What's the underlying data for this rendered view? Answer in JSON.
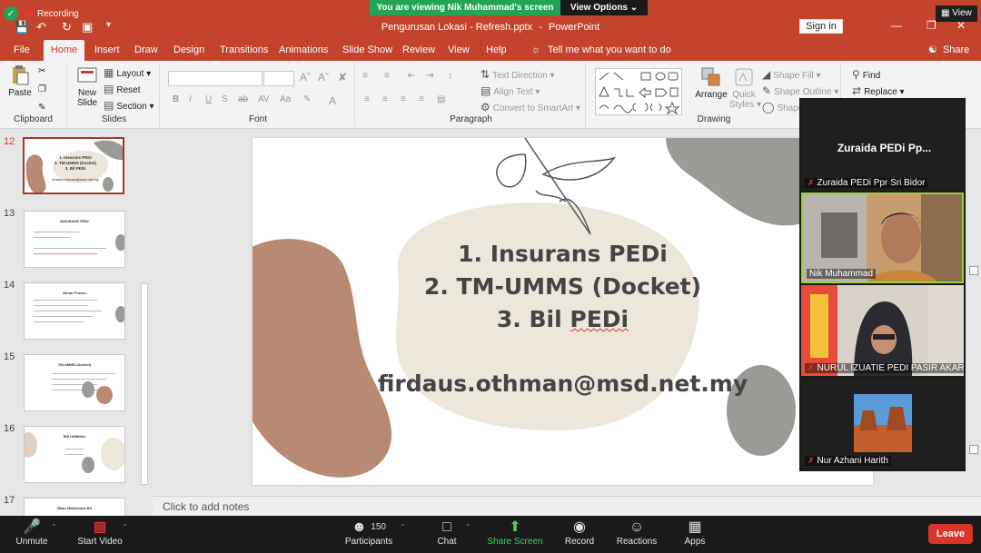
{
  "zoom_top": {
    "recording": "Recording",
    "viewing_banner": "You are viewing Nik Muhammad's screen",
    "view_options": "View Options",
    "view": "View"
  },
  "titlebar": {
    "doc_title": "Pengurusan Lokasi - Refresh.pptx",
    "separator": "-",
    "app_name": "PowerPoint",
    "sign_in": "Sign in"
  },
  "tabs": [
    "File",
    "Home",
    "Insert",
    "Draw",
    "Design",
    "Transitions",
    "Animations",
    "Slide Show",
    "Review",
    "View",
    "Help"
  ],
  "tell_me": "Tell me what you want to do",
  "share": "Share",
  "ribbon": {
    "clipboard": {
      "label": "Clipboard",
      "paste": "Paste"
    },
    "slides": {
      "label": "Slides",
      "new_slide": "New",
      "new_slide2": "Slide",
      "layout": "Layout",
      "reset": "Reset",
      "section": "Section"
    },
    "font": {
      "label": "Font"
    },
    "paragraph": {
      "label": "Paragraph",
      "text_direction": "Text Direction",
      "align_text": "Align Text",
      "smartart": "Convert to SmartArt"
    },
    "drawing": {
      "label": "Drawing",
      "arrange": "Arrange",
      "quick_styles": "Quick",
      "quick_styles2": "Styles",
      "shape_fill": "Shape Fill",
      "shape_outline": "Shape Outline",
      "shape_effects": "Shape"
    },
    "editing": {
      "find": "Find",
      "replace": "Replace"
    }
  },
  "thumbnails": [
    {
      "num": "12",
      "title": "1. Insurans PEDi\n2. TM-UMMS (Docket)\n3. Bil PEDi",
      "active": true
    },
    {
      "num": "13",
      "title": "INSURANS PEDi"
    },
    {
      "num": "14",
      "title": "Aliran Proses"
    },
    {
      "num": "15",
      "title": "TM-UMMS (Docket)"
    },
    {
      "num": "16",
      "title": "Bill UHMiltes"
    },
    {
      "num": "17",
      "title": "Bilan Maklumma Bil"
    }
  ],
  "slide": {
    "line1": "1. Insurans PEDi",
    "line2": "2. TM-UMMS (Docket)",
    "line3_prefix": "3. Bil ",
    "line3_word": "PEDi",
    "email": "firdaus.othman@msd.net.my",
    "notes_placeholder": "Click to add notes"
  },
  "participants_panel": {
    "big_name": "Zuraida PEDi Pp...",
    "tiles": [
      {
        "name": "Zuraida PEDi Ppr Sri Bidor",
        "muted": true
      },
      {
        "name": "Nik Muhammad",
        "muted": false
      },
      {
        "name": "NURUL IZUATIE PEDI PASIR AKAR",
        "muted": true
      },
      {
        "name": "Nur Azhani Harith",
        "muted": true
      }
    ]
  },
  "zoom_bar": {
    "unmute": "Unmute",
    "start_video": "Start Video",
    "participants": "Participants",
    "participants_count": "150",
    "chat": "Chat",
    "share_screen": "Share Screen",
    "record": "Record",
    "reactions": "Reactions",
    "apps": "Apps",
    "leave": "Leave"
  },
  "colors": {
    "ppt_accent": "#c4432c",
    "zoom_green": "#23a455",
    "leave_red": "#d9352b"
  }
}
